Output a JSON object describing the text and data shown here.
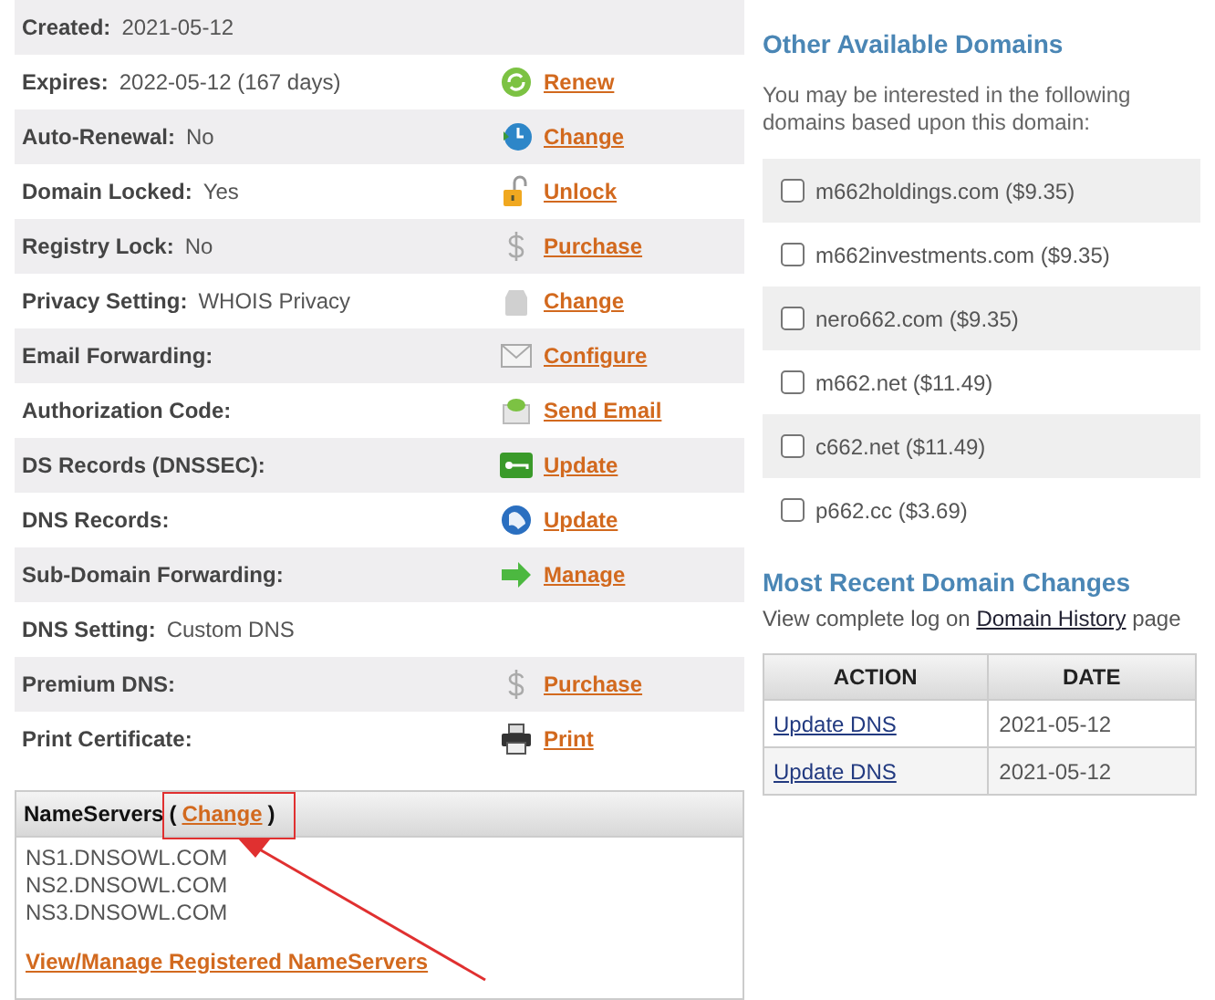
{
  "details": [
    {
      "label": "Created:",
      "value": "2021-05-12"
    },
    {
      "label": "Expires:",
      "value": "2022-05-12 (167 days)",
      "kind": "renew",
      "action": "Renew"
    },
    {
      "label": "Auto-Renewal:",
      "value": "No",
      "kind": "clock",
      "action": "Change"
    },
    {
      "label": "Domain Locked:",
      "value": "Yes",
      "kind": "padlock",
      "action": "Unlock"
    },
    {
      "label": "Registry Lock:",
      "value": "No",
      "kind": "dollar",
      "action": "Purchase"
    },
    {
      "label": "Privacy Setting:",
      "value": "WHOIS Privacy",
      "kind": "bag",
      "action": "Change"
    },
    {
      "label": "Email Forwarding:",
      "kind": "envelope",
      "action": "Configure"
    },
    {
      "label": "Authorization Code:",
      "kind": "mail",
      "action": "Send Email"
    },
    {
      "label": "DS Records (DNSSEC):",
      "kind": "key",
      "action": "Update"
    },
    {
      "label": "DNS Records:",
      "kind": "globe",
      "action": "Update"
    },
    {
      "label": "Sub-Domain Forwarding:",
      "kind": "arrow",
      "action": "Manage"
    },
    {
      "label": "DNS Setting:",
      "value": "Custom DNS"
    },
    {
      "label": "Premium DNS:",
      "kind": "dollar",
      "action": "Purchase"
    },
    {
      "label": "Print Certificate:",
      "kind": "printer",
      "action": "Print"
    }
  ],
  "nameservers": {
    "title": "NameServers",
    "open": "(",
    "link": "Change",
    "close": ")",
    "servers": [
      "NS1.DNSOWL.COM",
      "NS2.DNSOWL.COM",
      "NS3.DNSOWL.COM"
    ],
    "manage_link": "View/Manage Registered NameServers"
  },
  "other_domains": {
    "title": "Other Available Domains",
    "intro": "You may be interested in the following domains based upon this domain:",
    "items": [
      {
        "label": "m662holdings.com ($9.35)",
        "checked": false
      },
      {
        "label": "m662investments.com ($9.35)",
        "checked": false
      },
      {
        "label": "nero662.com ($9.35)",
        "checked": false
      },
      {
        "label": "m662.net ($11.49)",
        "checked": false
      },
      {
        "label": "c662.net ($11.49)",
        "checked": false
      },
      {
        "label": "p662.cc ($3.69)",
        "checked": false
      }
    ]
  },
  "recent_changes": {
    "title": "Most Recent Domain Changes",
    "note_before": "View complete log on",
    "note_link": "Domain History",
    "note_after": "page",
    "columns": [
      "ACTION",
      "DATE"
    ],
    "rows": [
      {
        "action": "Update DNS",
        "date": "2021-05-12"
      },
      {
        "action": "Update DNS",
        "date": "2021-05-12"
      }
    ]
  }
}
